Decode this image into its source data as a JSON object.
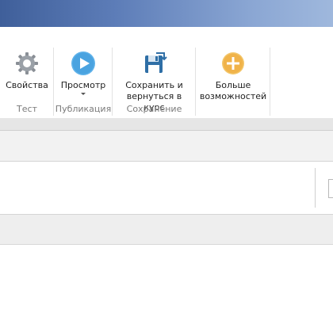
{
  "ribbon": {
    "groups": [
      {
        "label": "Тест",
        "buttons": [
          {
            "label": "Свойства",
            "icon": "gear-icon"
          }
        ]
      },
      {
        "label": "Публикация",
        "buttons": [
          {
            "label": "Просмотр",
            "icon": "play-icon",
            "has_dropdown": true
          }
        ]
      },
      {
        "label": "Сохранение",
        "buttons": [
          {
            "label_line1": "Сохранить и",
            "label_line2": "вернуться в курс",
            "icon": "save-return-icon"
          }
        ]
      },
      {
        "label": "",
        "buttons": [
          {
            "label_line1": "Больше",
            "label_line2": "возможностей",
            "icon": "plus-circle-icon"
          }
        ]
      }
    ]
  },
  "colors": {
    "titlebar": "#4a6aa8",
    "play": "#4aa3e0",
    "plus": "#f0b34a"
  }
}
